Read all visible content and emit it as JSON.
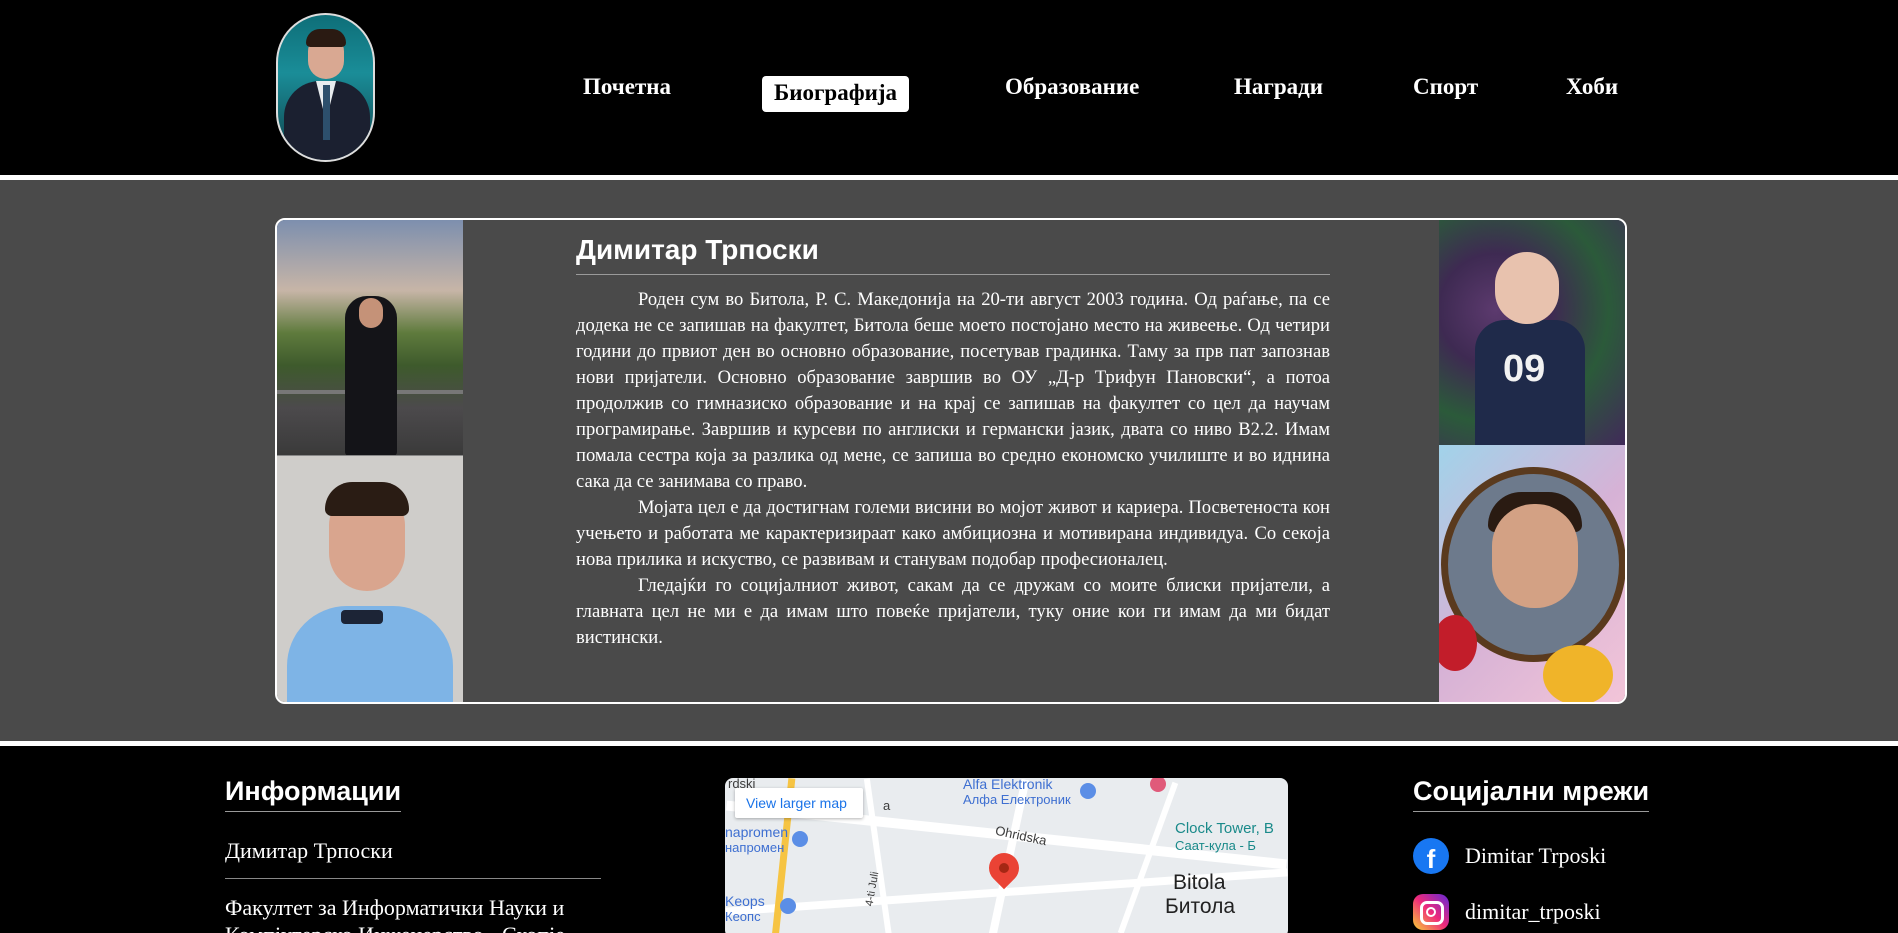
{
  "nav": {
    "items": [
      "Почетна",
      "Биографија",
      "Образование",
      "Награди",
      "Спорт",
      "Хоби"
    ],
    "active_index": 1
  },
  "bio": {
    "title": "Димитар Трпоски",
    "paragraphs": [
      "Роден сум во Битола, Р. С. Македонија на 20-ти август 2003 година. Од раѓање, па се додека не се запишав на факултет, Битола беше моето постојано место на живеење. Од четири години до првиот ден во основно образование, посетував градинка. Таму за прв пат запознав нови пријатели. Основно образование завршив во ОУ „Д-р Трифун Пановски“, а потоа продолжив со гимназиско образование и на крај се запишав на факултет со цел да научам програмирање. Завршив и курсеви по англиски и германски јазик, двата со ниво B2.2. Имам помала сестра која за разлика од мене, се запиша во средно економско училиште и во иднина сака да се занимава со право.",
      "Мојата цел е да достигнам големи висини во мојот живот и кариера. Посветеноста кон учењето и работата ме карактеризираат како амбициозна и мотивирана индивидуа. Со секоја нова прилика и искуство, се развивам и станувам подобар професионалец.",
      "Гледајќи го социјалниот живот, сакам да се дружам со моите блиски пријатели, а главната цел не ми е да имам што повеќе пријатели, туку оние кои ги имам да ми бидат вистински."
    ]
  },
  "photos": {
    "right_top_shirt_number": "09"
  },
  "footer": {
    "info": {
      "heading": "Информации",
      "name": "Димитар Трпоски",
      "faculty": "Факултет за Информатички Науки и Компјутерско Инженерство - Скопје"
    },
    "map": {
      "link": "View larger map",
      "labels": {
        "alfa_en": "Alfa Elektronik",
        "alfa_mk": "Алфа Електроник",
        "clock_en": "Clock Tower, B",
        "clock_mk": "Саат-кула - Б",
        "ohridska": "Ohridska",
        "city_en": "Bitola",
        "city_mk": "Битола",
        "keops_en": "Keops",
        "keops_mk": "Кеопс",
        "napromen_en": "napromen",
        "napromen_mk": "напромен",
        "ohridski": "rdski",
        "street_4": "4-ti Juli",
        "street_a": "a"
      }
    },
    "social": {
      "heading": "Социјални мрежи",
      "facebook": "Dimitar Trposki",
      "instagram": "dimitar_trposki"
    }
  },
  "colors": {
    "header_bg": "#000000",
    "main_bg": "#4a4a4a",
    "facebook": "#1877f2",
    "map_link": "#1a73e8",
    "map_pin": "#ea4335"
  }
}
